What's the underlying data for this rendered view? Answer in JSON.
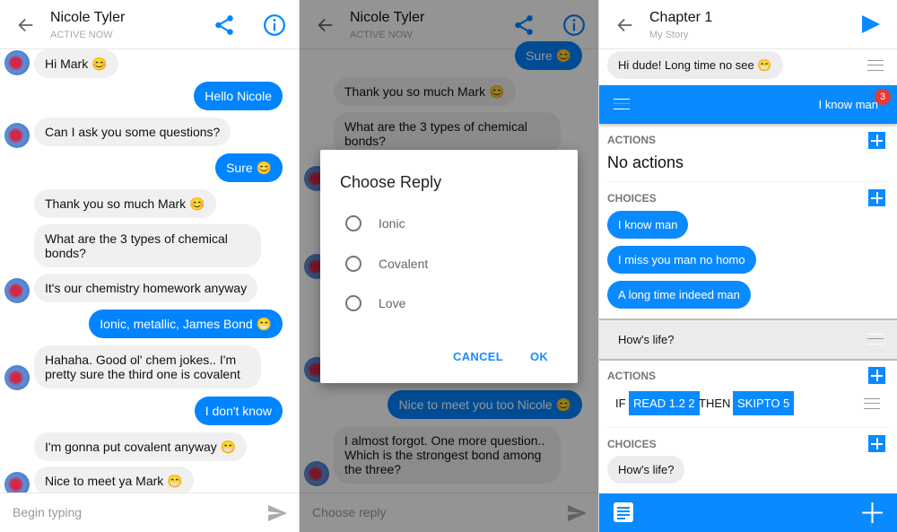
{
  "colors": {
    "messenger_blue": "#0084ff",
    "accent_blue": "#0a8aff",
    "badge_red": "#e53935"
  },
  "chat": {
    "contact_name": "Nicole Tyler",
    "status": "ACTIVE NOW",
    "icons": [
      "back-arrow-icon",
      "share-icon",
      "info-icon",
      "send-icon"
    ],
    "messages": [
      {
        "from": "them",
        "text": "Hi Mark 😊"
      },
      {
        "from": "me",
        "text": "Hello Nicole"
      },
      {
        "from": "them",
        "text": "Can I ask you some questions?"
      },
      {
        "from": "me",
        "text": "Sure 😊"
      },
      {
        "from": "them",
        "text": "Thank you so much Mark 😊"
      },
      {
        "from": "them",
        "text": "What are the 3 types of chemical bonds?"
      },
      {
        "from": "them",
        "text": "It's our chemistry homework anyway"
      },
      {
        "from": "me",
        "text": "Ionic, metallic, James Bond 😁"
      },
      {
        "from": "them",
        "text": "Hahaha. Good ol' chem jokes.. I'm pretty sure the third one is covalent"
      },
      {
        "from": "me",
        "text": "I don't know"
      },
      {
        "from": "them",
        "text": "I'm gonna put covalent anyway 😁"
      },
      {
        "from": "them",
        "text": "Nice to meet ya Mark 😁"
      }
    ],
    "input_placeholder": "Begin typing"
  },
  "chat2": {
    "messages": [
      {
        "from": "me",
        "text": "Sure 😊"
      },
      {
        "from": "them",
        "text": "Thank you so much Mark 😊"
      },
      {
        "from": "them",
        "text": "What are the 3 types of chemical bonds?"
      },
      {
        "from": "me",
        "text": "Nice to meet you too Nicole 😊"
      },
      {
        "from": "them",
        "text": "I almost forgot. One more question.. Which is the strongest bond among the three?"
      }
    ],
    "input_placeholder": "Choose reply",
    "dialog": {
      "title": "Choose Reply",
      "options": [
        "Ionic",
        "Covalent",
        "Love"
      ],
      "cancel": "CANCEL",
      "ok": "OK"
    }
  },
  "editor": {
    "title": "Chapter 1",
    "subtitle": "My Story",
    "message1": "Hi dude! Long time no see 😁",
    "selected_choice": "I know man",
    "badge_count": "3",
    "actions_label": "ACTIONS",
    "no_actions": "No actions",
    "choices_label": "CHOICES",
    "choices": [
      "I know man",
      "I miss you man no homo",
      "A long time indeed man"
    ],
    "message2": "How's life?",
    "actions2_label": "ACTIONS",
    "condition": {
      "if": "IF",
      "read": "READ 1.2 2",
      "then": "THEN",
      "skip": "SKIPTO 5"
    },
    "choices2_label": "CHOICES",
    "choices2": [
      "How's life?"
    ]
  }
}
